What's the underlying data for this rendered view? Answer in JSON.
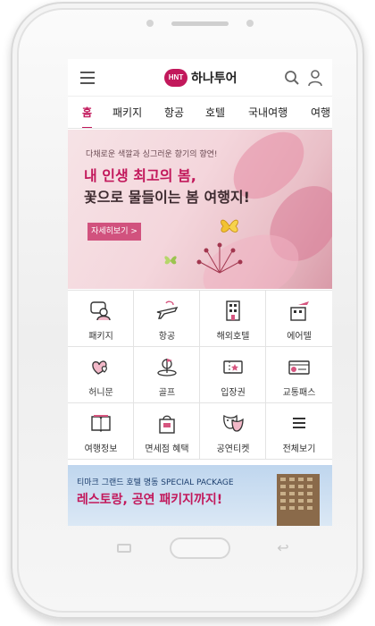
{
  "app": {
    "logo_badge": "HNT",
    "logo_text": "하나투어"
  },
  "tabs": [
    {
      "label": "홈",
      "active": true
    },
    {
      "label": "패키지"
    },
    {
      "label": "항공"
    },
    {
      "label": "호텔"
    },
    {
      "label": "국내여행"
    },
    {
      "label": "여행"
    }
  ],
  "banner": {
    "subtitle": "다채로운 색깔과 싱그러운 향기의 향연!",
    "title_line1": "내 인생 최고의 봄,",
    "title_line2": "꽃으로 물들이는 봄 여행지!",
    "button_label": "자세히보기 >"
  },
  "grid": [
    {
      "label": "패키지",
      "icon": "package-traveler-icon"
    },
    {
      "label": "항공",
      "icon": "airplane-icon"
    },
    {
      "label": "해외호텔",
      "icon": "hotel-building-icon"
    },
    {
      "label": "에어텔",
      "icon": "airtel-icon"
    },
    {
      "label": "허니문",
      "icon": "hearts-icon"
    },
    {
      "label": "골프",
      "icon": "golf-icon"
    },
    {
      "label": "입장권",
      "icon": "ticket-icon"
    },
    {
      "label": "교통패스",
      "icon": "transport-pass-icon"
    },
    {
      "label": "여행정보",
      "icon": "book-icon"
    },
    {
      "label": "면세점 혜택",
      "icon": "duty-free-bag-icon"
    },
    {
      "label": "공연티켓",
      "icon": "theater-mask-icon"
    },
    {
      "label": "전체보기",
      "icon": "menu-lines-icon"
    }
  ],
  "ad": {
    "subtitle": "티마크 그랜드 호텔 명동 SPECIAL PACKAGE",
    "title": "레스토랑, 공연 패키지까지!"
  },
  "colors": {
    "accent": "#c2185b",
    "icon_pink": "#d6557f"
  }
}
